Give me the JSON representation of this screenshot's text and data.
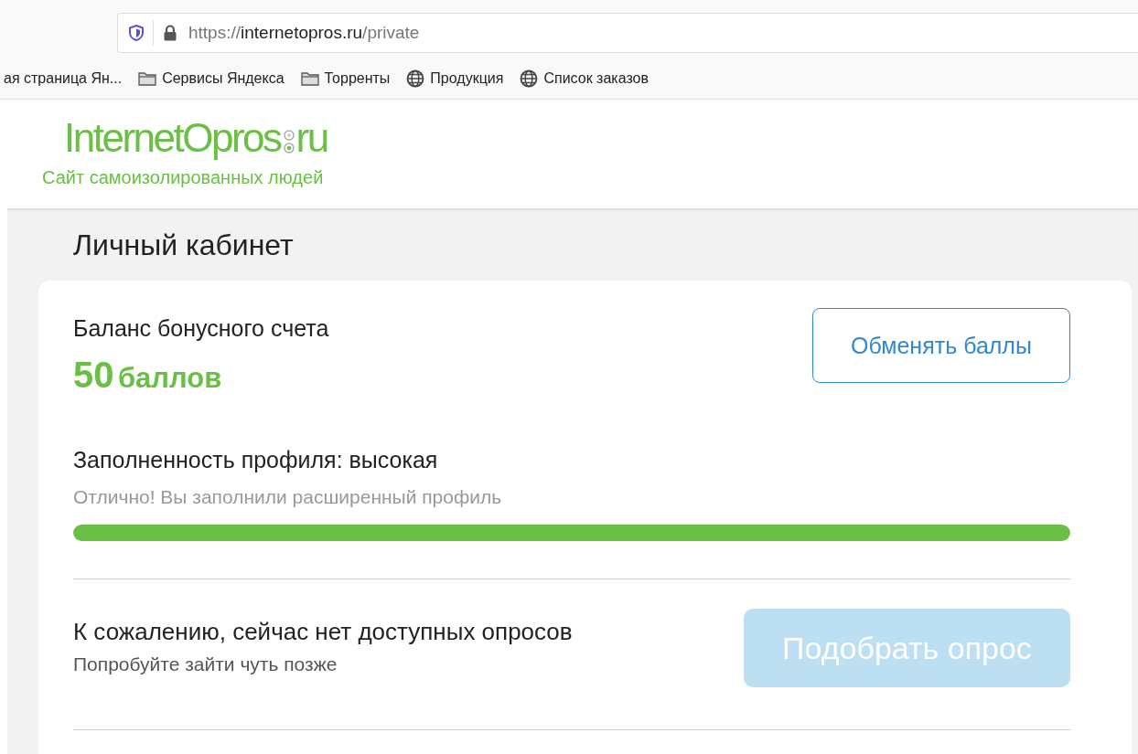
{
  "address_bar": {
    "scheme": "https://",
    "host": "internetopros.ru",
    "path": "/private"
  },
  "bookmarks": [
    {
      "kind": "text",
      "label": "ая страница Ян..."
    },
    {
      "kind": "folder",
      "label": "Сервисы Яндекса"
    },
    {
      "kind": "folder",
      "label": "Торренты"
    },
    {
      "kind": "globe",
      "label": "Продукция"
    },
    {
      "kind": "globe",
      "label": "Список заказов"
    }
  ],
  "logo": {
    "name": "InternetOpros",
    "suffix": "ru",
    "tagline": "Сайт самоизолированных людей"
  },
  "page_title": "Личный кабинет",
  "balance": {
    "label": "Баланс бонусного счета",
    "amount": "50",
    "unit": "баллов",
    "button": "Обменять баллы"
  },
  "profile": {
    "label": "Заполненность профиля: высокая",
    "hint": "Отлично! Вы заполнили расширенный профиль",
    "level": 1
  },
  "surveys": {
    "message": "К сожалению, сейчас нет доступных опросов",
    "hint": "Попробуйте зайти чуть позже",
    "button": "Подобрать опрос",
    "disabled": true
  }
}
